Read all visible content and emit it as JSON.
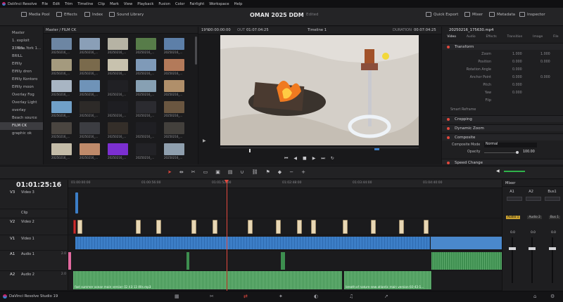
{
  "menubar": {
    "items": [
      "DaVinci Resolve",
      "File",
      "Edit",
      "Trim",
      "Timeline",
      "Clip",
      "Mark",
      "View",
      "Playback",
      "Fusion",
      "Color",
      "Fairlight",
      "Workspace",
      "Help"
    ]
  },
  "toolbar": {
    "left": [
      "Media Pool",
      "Effects",
      "Index",
      "Sound Library"
    ],
    "project_title": "OMAN 2025 DDM",
    "status": "Edited",
    "right": [
      "Quick Export",
      "Mixer",
      "Metadata",
      "Inspector"
    ]
  },
  "bins": {
    "items": [
      "Master",
      "1. exploit 13.03...",
      "2. New York 1...",
      "BRILL",
      "Elfilly",
      "Elfilly dren",
      "Elfilly Kontoro",
      "Elfilly moon",
      "Overlay Fog",
      "Overlay Light",
      "overlay",
      "Beach source",
      "FILM CK",
      "graphic ok"
    ],
    "selected_index": 12
  },
  "pool": {
    "header": "Master / FILM CK",
    "clips": [
      {
        "label": "20250216_...",
        "color": "#6d86a3"
      },
      {
        "label": "20250216_...",
        "color": "#8a9fb7"
      },
      {
        "label": "20250216_...",
        "color": "#b6b3a4"
      },
      {
        "label": "20250216_...",
        "color": "#577c49"
      },
      {
        "label": "20250216_...",
        "color": "#5d7fa8"
      },
      {
        "label": "20250216_...",
        "color": "#a49a7e"
      },
      {
        "label": "20250216_...",
        "color": "#7a6a4c"
      },
      {
        "label": "20250216_...",
        "color": "#c8c2ae"
      },
      {
        "label": "20250216_...",
        "color": "#7f9ab8"
      },
      {
        "label": "20250216_...",
        "color": "#b37a5a"
      },
      {
        "label": "20250216_...",
        "color": "#a8b5c3"
      },
      {
        "label": "20250216_...",
        "color": "#6f93b8"
      },
      {
        "label": "20250216_...",
        "color": "#202024"
      },
      {
        "label": "20250216_...",
        "color": "#87a0b3"
      },
      {
        "label": "20250216_...",
        "color": "#b08f6a"
      },
      {
        "label": "20250216_...",
        "color": "#70a0c8"
      },
      {
        "label": "20250216_...",
        "color": "#2d2a28"
      },
      {
        "label": "20250216_...",
        "color": "#1e1e22"
      },
      {
        "label": "20250216_...",
        "color": "#2b2b30"
      },
      {
        "label": "20250216_...",
        "color": "#6a5640"
      },
      {
        "label": "20250216_...",
        "color": "#4a4540"
      },
      {
        "label": "20250216_...",
        "color": "#3c3d42"
      },
      {
        "label": "20250216_...",
        "color": "#342e29"
      },
      {
        "label": "20250216_...",
        "color": "#1f1f23"
      },
      {
        "label": "20250216_...",
        "color": "#43403c"
      },
      {
        "label": "20250216_...",
        "color": "#c4bca8"
      },
      {
        "label": "20250216_...",
        "color": "#bf8a6a"
      },
      {
        "label": "20250216_...",
        "color": "#7b2fd0"
      },
      {
        "label": "20250216_...",
        "color": "#222226"
      },
      {
        "label": "20250216_...",
        "color": "#8f9fae"
      }
    ]
  },
  "viewer": {
    "zoom": "19%",
    "src_tc": "00:00:00:00",
    "out_label": "OUT",
    "out_tc": "01:07:04:25",
    "timeline_name": "Timeline 1",
    "duration_label": "DURATION",
    "duration_tc": "00:07:04:25"
  },
  "inspector": {
    "clip_name": "20250216_175630.mp4",
    "tabs": [
      "Video",
      "Audio",
      "Effects",
      "Transition",
      "Image",
      "File"
    ],
    "transform_label": "Transform",
    "fields": [
      {
        "label": "Zoom",
        "x": "1.000",
        "y": "1.000"
      },
      {
        "label": "Position",
        "x": "0.000",
        "y": "0.000"
      },
      {
        "label": "Rotation Angle",
        "x": "0.000",
        "y": ""
      },
      {
        "label": "Anchor Point",
        "x": "0.000",
        "y": "0.000"
      },
      {
        "label": "Pitch",
        "x": "0.000",
        "y": ""
      },
      {
        "label": "Yaw",
        "x": "0.000",
        "y": ""
      },
      {
        "label": "Flip",
        "x": "",
        "y": ""
      }
    ],
    "smart_reframe": "Smart Reframe",
    "sections": [
      "Cropping",
      "Dynamic Zoom",
      "Composite",
      "Speed Change"
    ],
    "composite_mode_label": "Composite Mode",
    "composite_mode_value": "Normal",
    "opacity_label": "Opacity",
    "opacity_value": "100.00"
  },
  "timeline": {
    "timecode": "01:01:25:16",
    "ruler_labels": [
      "01:00:00:00",
      "01:00:56:00",
      "01:01:52:00",
      "01:02:48:00",
      "01:03:44:00",
      "01:04:40:00"
    ],
    "tracks": [
      {
        "id": "V3",
        "name": "Video 3"
      },
      {
        "id": "",
        "name": "Clip"
      },
      {
        "id": "V2",
        "name": "Video 2"
      },
      {
        "id": "V1",
        "name": "Video 1"
      },
      {
        "id": "A1",
        "name": "Audio 1",
        "level": "2.0"
      },
      {
        "id": "A2",
        "name": "Audio 2",
        "level": "2.0"
      }
    ],
    "audio2_clip1": "fast summer ocean main version 02 43 13 40s.mp3",
    "audio2_clip2": "breath of nature new atlantic main version 02-43-1...",
    "playhead_tc_fraction": 0.367
  },
  "mixer": {
    "title": "Mixer",
    "channels": [
      "A1",
      "A2",
      "Bus1"
    ],
    "strip_labels": [
      "Audio 1",
      "Audio 2",
      "Bus 1"
    ],
    "fader_values": [
      "0.0",
      "0.0",
      "0.0"
    ]
  },
  "bottombar": {
    "app_name": "DaVinci Resolve Studio 19",
    "pages": [
      "media",
      "cut",
      "edit",
      "fusion",
      "color",
      "fairlight",
      "deliver"
    ],
    "active_page": "edit"
  },
  "colors": {
    "accent": "#e5483e",
    "video_track": "#3c7ec7",
    "audio_track": "#3d8e4f",
    "panel": "#1f1f21"
  }
}
